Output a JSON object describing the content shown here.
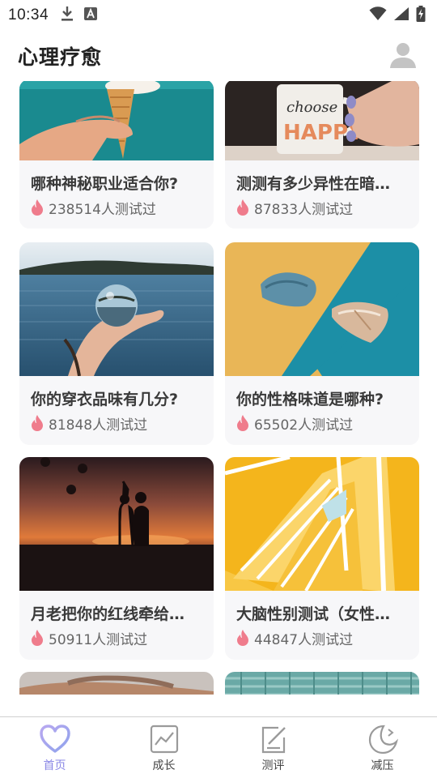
{
  "status_bar": {
    "time": "10:34",
    "icons": [
      "download-icon",
      "a-notification-icon",
      "wifi-icon",
      "signal-icon",
      "battery-charging-icon"
    ]
  },
  "header": {
    "title": "心理疗愈",
    "profile_icon": "user-avatar-icon"
  },
  "cards": [
    {
      "title": "哪种神秘职业适合你?",
      "count": "238514人测试过",
      "image": "hand-holding-ice-cream-cone"
    },
    {
      "title": "测测有多少异性在暗…",
      "count": "87833人测试过",
      "image": "hands-holding-choose-happy-mug"
    },
    {
      "title": "你的穿衣品味有几分?",
      "count": "81848人测试过",
      "image": "hand-holding-crystal-ball-by-sea"
    },
    {
      "title": "你的性格味道是哪种?",
      "count": "65502人测试过",
      "image": "two-stones-on-yellow-and-teal"
    },
    {
      "title": "月老把你的红线牵给…",
      "count": "50911人测试过",
      "image": "couple-silhouette-at-sunset"
    },
    {
      "title": "大脑性别测试（女性…",
      "count": "44847人测试过",
      "image": "yellow-spiral-staircase"
    }
  ],
  "tabs": [
    {
      "label": "首页",
      "icon": "heart-icon",
      "active": true
    },
    {
      "label": "成长",
      "icon": "growth-chart-icon",
      "active": false
    },
    {
      "label": "测评",
      "icon": "edit-test-icon",
      "active": false
    },
    {
      "label": "减压",
      "icon": "moon-icon",
      "active": false
    }
  ],
  "colors": {
    "accent": "#8a87e6",
    "flame": "#ef7c8c",
    "card_bg": "#f7f7f9"
  }
}
